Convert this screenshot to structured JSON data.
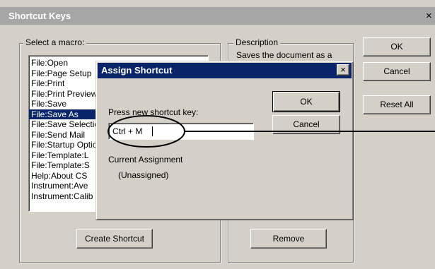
{
  "window": {
    "title": "Shortcut Keys",
    "close_glyph": "×"
  },
  "macros": {
    "group_label": "Select a macro:",
    "items": [
      "File:Open",
      "File:Page Setup",
      "File:Print",
      "File:Print Preview",
      "File:Save",
      "File:Save As",
      "File:Save Selection",
      "File:Send Mail",
      "File:Startup Options",
      "File:Template:L",
      "File:Template:S",
      "Help:About CS",
      "Instrument:Ave",
      "Instrument:Calib"
    ],
    "selected_index": 5
  },
  "description": {
    "group_label": "Description",
    "text": "Saves the document as a"
  },
  "buttons": {
    "ok": "OK",
    "cancel": "Cancel",
    "reset_all": "Reset All",
    "create_shortcut": "Create Shortcut",
    "remove": "Remove"
  },
  "assign_dialog": {
    "title": "Assign Shortcut",
    "close_glyph": "×",
    "prompt": "Press new shortcut key:",
    "shortcut_value": "Ctrl + M",
    "current_label": "Current Assignment",
    "current_value": "(Unassigned)",
    "ok": "OK",
    "cancel": "Cancel"
  },
  "annotation": {
    "callout_color": "#000000"
  }
}
